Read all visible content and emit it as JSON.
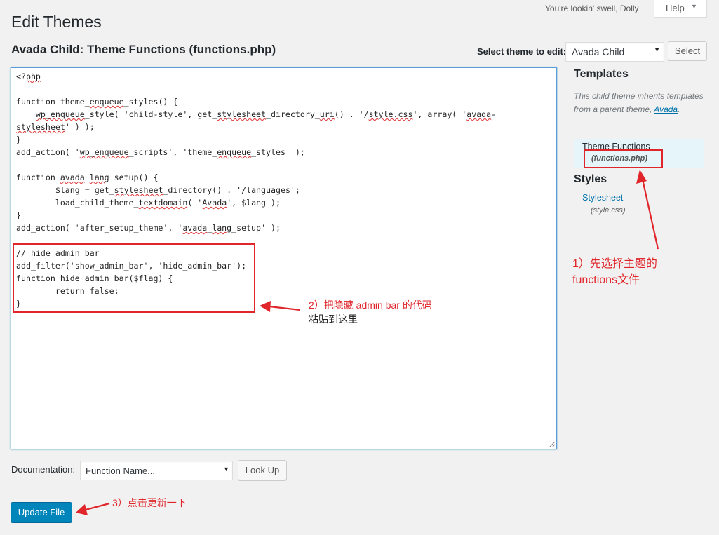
{
  "header": {
    "title": "Edit Themes",
    "howdy": "You're lookin' swell, Dolly",
    "help_label": "Help"
  },
  "editor": {
    "file_heading": "Avada Child: Theme Functions (functions.php)",
    "select_label": "Select theme to edit:",
    "selected_theme": "Avada Child",
    "select_button": "Select"
  },
  "sidebar": {
    "templates_title": "Templates",
    "inherit_note": "This child theme inherits templates from a parent theme,",
    "parent_theme_link": "Avada",
    "templates": [
      {
        "name": "Theme Functions",
        "file": "(functions.php)"
      }
    ],
    "styles_title": "Styles",
    "styles": [
      {
        "name": "Stylesheet",
        "file": "(style.css)"
      }
    ]
  },
  "documentation": {
    "label": "Documentation:",
    "selected": "Function Name...",
    "lookup_button": "Look Up"
  },
  "update_button": "Update File",
  "annotations": {
    "step1_line1": "1）先选择主题的",
    "step1_line2": "functions文件",
    "step2_line1": "2）把隐藏 admin bar 的代码",
    "step2_line2": "粘贴到这里",
    "step3": "3）点击更新一下",
    "color": "#e0262b"
  }
}
